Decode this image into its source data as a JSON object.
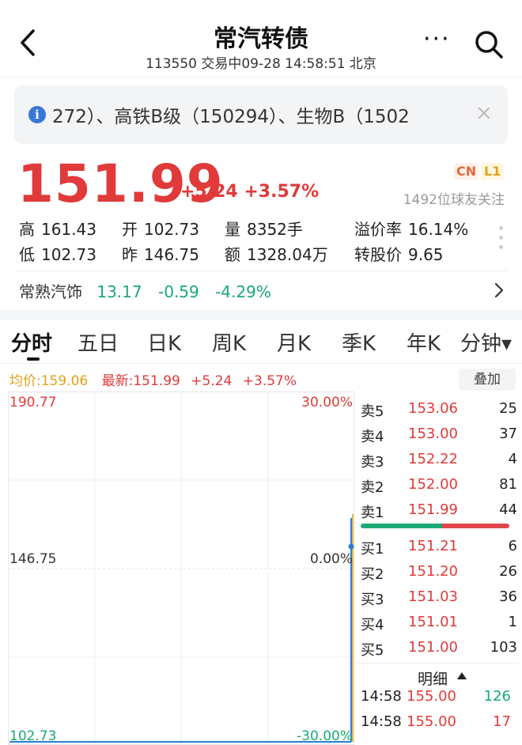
{
  "header": {
    "title": "常汽转债",
    "subtitle": "113550 交易中09-28 14:58:51 北京",
    "more_label": "···"
  },
  "banner": {
    "info_glyph": "i",
    "text": "272）、高铁B级（150294）、生物B（1502",
    "close_glyph": "×"
  },
  "quote": {
    "price": "151.99",
    "change": "+5.24 +3.57%",
    "badge_cn": "CN",
    "badge_l1": "L1",
    "followers": "1492位球友关注"
  },
  "stats": {
    "high": {
      "key": "高",
      "value": "161.43"
    },
    "open": {
      "key": "开",
      "value": "102.73"
    },
    "volume": {
      "key": "量",
      "value": "8352手"
    },
    "premium": {
      "key": "溢价率",
      "value": "16.14%"
    },
    "low": {
      "key": "低",
      "value": "102.73"
    },
    "prev": {
      "key": "昨",
      "value": "146.75"
    },
    "amount": {
      "key": "额",
      "value": "1328.04万"
    },
    "conv": {
      "key": "转股价",
      "value": "9.65"
    }
  },
  "related": {
    "name": "常熟汽饰",
    "price": "13.17",
    "change": "-0.59",
    "pct": "-4.29%"
  },
  "tabs": [
    "分时",
    "五日",
    "日K",
    "周K",
    "月K",
    "季K",
    "年K",
    "分钟▾"
  ],
  "chart_header": {
    "avg": "均价:159.06",
    "latest": "最新:151.99",
    "change": "+5.24",
    "pct": "+3.57%",
    "overlay_label": "叠加"
  },
  "chart_axes": {
    "top_price": "190.77",
    "mid_price": "146.75",
    "bottom_price": "102.73",
    "top_pct": "30.00%",
    "mid_pct": "0.00%",
    "bottom_pct": "-30.00%"
  },
  "orderbook": {
    "asks": [
      {
        "label": "卖5",
        "price": "153.06",
        "vol": "25"
      },
      {
        "label": "卖4",
        "price": "153.00",
        "vol": "37"
      },
      {
        "label": "卖3",
        "price": "152.22",
        "vol": "4"
      },
      {
        "label": "卖2",
        "price": "152.00",
        "vol": "81"
      },
      {
        "label": "卖1",
        "price": "151.99",
        "vol": "44"
      }
    ],
    "buy_ratio": 0.55,
    "bids": [
      {
        "label": "买1",
        "price": "151.21",
        "vol": "6"
      },
      {
        "label": "买2",
        "price": "151.20",
        "vol": "26"
      },
      {
        "label": "买3",
        "price": "151.03",
        "vol": "36"
      },
      {
        "label": "买4",
        "price": "151.01",
        "vol": "1"
      },
      {
        "label": "买5",
        "price": "151.00",
        "vol": "103"
      }
    ],
    "detail_title": "明细",
    "ticks": [
      {
        "time": "14:58",
        "price": "155.00",
        "vol": "126",
        "color": "#19a974"
      },
      {
        "time": "14:58",
        "price": "155.00",
        "vol": "17",
        "color": "#e03a3a"
      }
    ]
  },
  "colors": {
    "up": "#e03a3a",
    "down": "#19a974",
    "avg_line": "#e0a21a",
    "price_line": "#2b7fd6"
  }
}
